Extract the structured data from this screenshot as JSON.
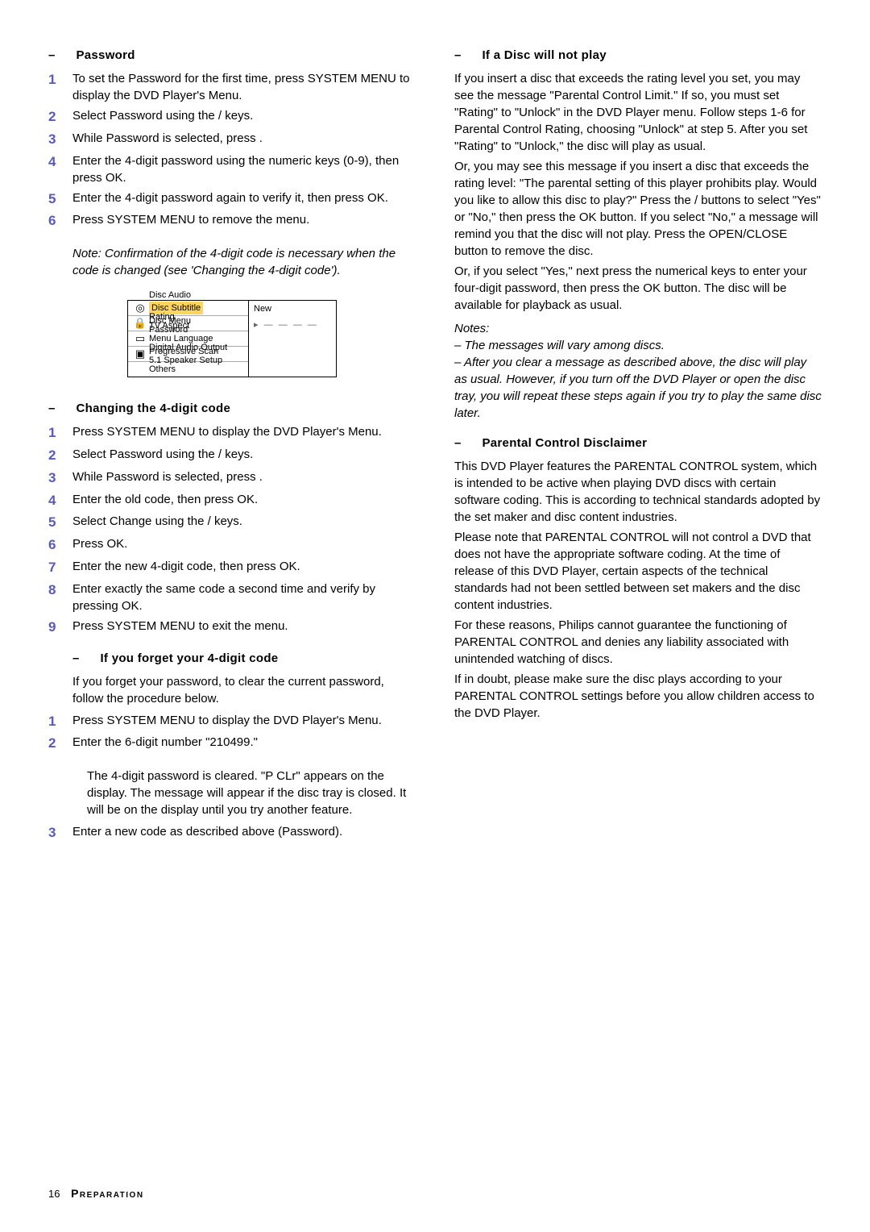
{
  "left": {
    "password": {
      "heading_dash": "–",
      "heading": "Password",
      "steps": [
        "To set the Password for the first time, press SYSTEM MENU to display the DVD Player's Menu.",
        "Select Password using the   /   keys.",
        "While Password is selected, press   .",
        "Enter the 4-digit password using the numeric keys (0-9), then press OK.",
        "Enter the 4-digit password again to verify it, then press OK.",
        "Press SYSTEM MENU to remove the menu."
      ],
      "note": "Note: Confirmation of the 4-digit code is necessary when the code is changed (see 'Changing the 4-digit code')."
    },
    "menu": {
      "disc_audio": "Disc Audio",
      "disc_subtitle": "Disc Subtitle",
      "disc_menu": "Disc Menu",
      "rating": "Rating",
      "password": "Password",
      "tv_aspect": "TV Aspect",
      "menu_language": "Menu Language",
      "progressive_scan": "Progressive Scan",
      "digital_audio": "Digital Audio Output",
      "speaker_setup": "5.1 Speaker Setup",
      "others": "Others",
      "new_label": "New",
      "placeholder": "▸ — — — —"
    },
    "change": {
      "heading_dash": "–",
      "heading": "Changing the 4-digit code",
      "steps": [
        "Press SYSTEM MENU to display the DVD Player's Menu.",
        "Select Password using the   /   keys.",
        "While Password is selected, press   .",
        "Enter the old code, then press OK.",
        "Select Change using the   /   keys.",
        "Press OK.",
        "Enter the new 4-digit code, then press OK.",
        "Enter exactly the same code a second time and verify by pressing OK.",
        "Press SYSTEM MENU to exit the menu."
      ]
    },
    "forget": {
      "heading_dash": "–",
      "heading": "If you forget your 4-digit code",
      "intro": "If you forget your password, to clear the current password, follow the procedure below.",
      "steps": [
        "Press SYSTEM MENU to display the DVD Player's Menu.",
        "Enter the 6-digit number \"210499.\"",
        "Enter a new code as described above (Password)."
      ],
      "after_step2": "The 4-digit password is cleared. \"P CLr\" appears on the display. The message will appear if the disc tray is closed. It will be on the display until you try another feature."
    }
  },
  "right": {
    "noplay": {
      "heading_dash": "–",
      "heading": "If a Disc will not play",
      "p1": "If you insert a disc that exceeds the rating level you set, you may see the message \"Parental Control Limit.\"  If so, you must set \"Rating\" to \"Unlock\" in the DVD Player menu. Follow steps 1-6 for Parental Control Rating, choosing \"Unlock\" at step 5. After you set \"Rating\" to \"Unlock,\" the disc will play as usual.",
      "p2": "Or, you may see this message if you insert a disc that exceeds the rating level: \"The parental setting of this player prohibits play. Would you like to allow this disc to play?\" Press the   /   buttons to select \"Yes\" or \"No,\" then press the OK button. If you select \"No,\" a message will remind you that the disc will not play. Press the OPEN/CLOSE button to remove the disc.",
      "p3": "Or, if you select \"Yes,\" next press the numerical keys to enter your four-digit password, then press the OK button. The disc will be available for playback as usual.",
      "notes_h": "Notes:",
      "notes1": "–  The messages will vary among discs.",
      "notes2": "–  After you clear a message as described above, the disc will play as usual. However, if you turn off the DVD Player or open the disc tray, you will repeat these steps again if you try to play the same disc later."
    },
    "disclaimer": {
      "heading_dash": "–",
      "heading": "Parental Control Disclaimer",
      "p1": "This DVD Player features the PARENTAL CONTROL system, which is intended to be active when playing DVD discs with certain software coding. This is according to technical standards adopted by the set maker and disc content industries.",
      "p2": "Please note that PARENTAL CONTROL will not control a DVD that does not have the appropriate software coding. At the time of release of this DVD Player, certain aspects of the technical standards had not been settled between set makers and the disc content industries.",
      "p3": "For these reasons, Philips cannot guarantee the functioning of PARENTAL CONTROL and denies any liability associated with unintended watching of discs.",
      "p4": "If in doubt, please make sure the disc plays according to your PARENTAL CONTROL settings before you allow children access to the DVD Player."
    }
  },
  "footer": {
    "page": "16",
    "section": "Preparation"
  }
}
